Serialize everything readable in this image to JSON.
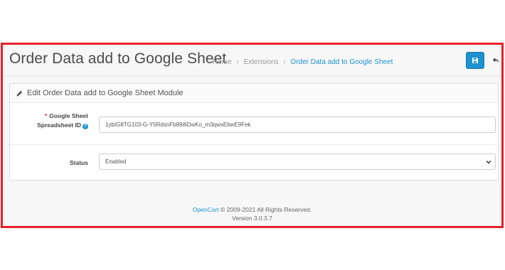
{
  "page": {
    "title": "Order Data add to Google Sheet",
    "breadcrumb": [
      "Home",
      "Extensions",
      "Order Data add to Google Sheet"
    ],
    "breadcrumb_separator": "›"
  },
  "toolbar": {
    "save_icon": "floppy-disk-icon",
    "back_icon": "reply-icon"
  },
  "panel": {
    "icon": "pencil-icon",
    "title": "Edit Order Data add to Google Sheet Module"
  },
  "form": {
    "spreadsheet": {
      "required_mark": "*",
      "label_line1": "Google Sheet",
      "label_line2": "Spreadsheet ID",
      "help_icon": "question-circle-icon",
      "help_glyph": "?",
      "value": "1ybIG8TG103-G-Y5RdsnFb89i6DwKo_m3qwsEbwE9Fek"
    },
    "status": {
      "label": "Status",
      "value": "Enabled"
    }
  },
  "footer": {
    "brand": "OpenCart",
    "copyright": "© 2009-2021 All Rights Reserved.",
    "version": "Version 3.0.3.7"
  },
  "colors": {
    "accent": "#1e91cf",
    "frame_border": "#e8202a",
    "required": "#e8202a"
  }
}
